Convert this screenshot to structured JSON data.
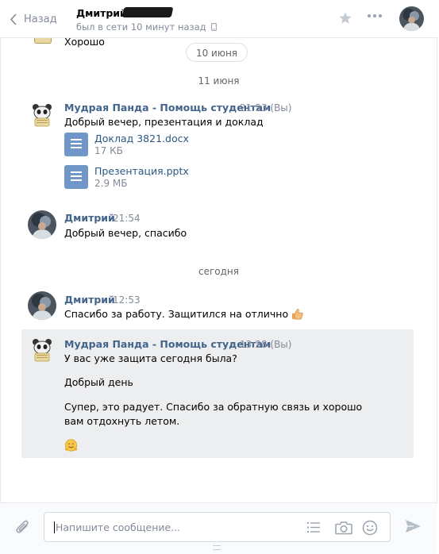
{
  "header": {
    "back_label": "Назад",
    "peer_name": "Дмитрий",
    "peer_status": "был в сети 10 минут назад"
  },
  "history": {
    "previous_text": "Хорошо",
    "date_pill": "10 июня",
    "date_11_june": "11 июня",
    "date_today": "сегодня",
    "messages": [
      {
        "author": "Мудрая Панда - Помощь студентам",
        "time": "21:53 (Вы)",
        "text": "Добрый вечер, презентация и доклад",
        "attachments": [
          {
            "name": "Доклад 3821.docx",
            "size": "17 КБ"
          },
          {
            "name": "Презентация.pptx",
            "size": "2.9 МБ"
          }
        ]
      },
      {
        "author": "Дмитрий",
        "time": "21:54",
        "text": "Добрый вечер, спасибо"
      },
      {
        "author": "Дмитрий",
        "time": "12:53",
        "text": "Спасибо за работу. Защитился на отлично"
      },
      {
        "author": "Мудрая Панда - Помощь студентам",
        "time": "13:28 (Вы)",
        "lines": [
          "У вас уже защита сегодня была?",
          "Добрый день",
          "Супер, это радует. Спасибо за обратную связь и хорошо вам отдохнуть летом."
        ]
      }
    ]
  },
  "composer": {
    "placeholder": "Напишите сообщение..."
  },
  "colors": {
    "link": "#2a5885",
    "author": "#42648b",
    "muted": "#828a99",
    "doc_icon": "#7196c8",
    "selected_bg": "#edeef0"
  }
}
